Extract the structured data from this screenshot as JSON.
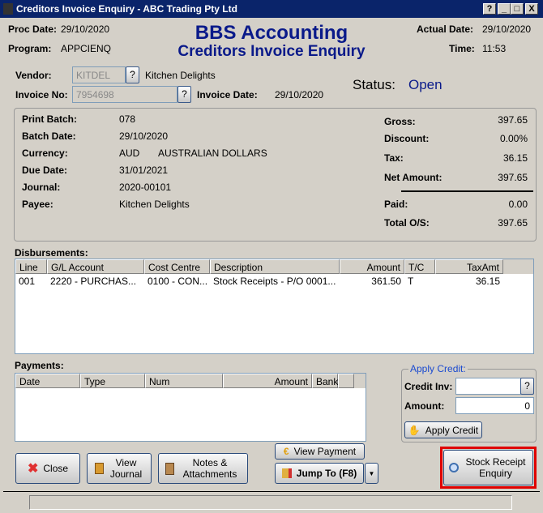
{
  "window": {
    "title": "Creditors Invoice Enquiry - ABC Trading Pty Ltd",
    "help": "?",
    "minimize": "_",
    "maximize": "□",
    "close": "X"
  },
  "header": {
    "proc_date_label": "Proc Date:",
    "proc_date": "29/10/2020",
    "program_label": "Program:",
    "program": "APPCIENQ",
    "app_title": "BBS Accounting",
    "screen_title": "Creditors Invoice Enquiry",
    "actual_date_label": "Actual Date:",
    "actual_date": "29/10/2020",
    "time_label": "Time:",
    "time": "11:53"
  },
  "vendor": {
    "label": "Vendor:",
    "code": "KITDEL",
    "name": "Kitchen Delights",
    "invoice_label": "Invoice No:",
    "invoice_no": "7954698",
    "invoice_date_label": "Invoice Date:",
    "invoice_date": "29/10/2020",
    "lookup": "?"
  },
  "status": {
    "label": "Status:",
    "value": "Open"
  },
  "details": {
    "print_batch_label": "Print Batch:",
    "print_batch": "078",
    "batch_date_label": "Batch Date:",
    "batch_date": "29/10/2020",
    "currency_label": "Currency:",
    "currency_code": "AUD",
    "currency_name": "AUSTRALIAN DOLLARS",
    "due_date_label": "Due Date:",
    "due_date": "31/01/2021",
    "journal_label": "Journal:",
    "journal": "2020-00101",
    "payee_label": "Payee:",
    "payee": "Kitchen Delights"
  },
  "totals": {
    "gross_label": "Gross:",
    "gross": "397.65",
    "discount_label": "Discount:",
    "discount": "0.00%",
    "tax_label": "Tax:",
    "tax": "36.15",
    "net_label": "Net Amount:",
    "net": "397.65",
    "paid_label": "Paid:",
    "paid": "0.00",
    "os_label": "Total O/S:",
    "os": "397.65"
  },
  "disbursements": {
    "label": "Disbursements:",
    "columns": [
      "Line",
      "G/L Account",
      "Cost Centre",
      "Description",
      "Amount",
      "T/C",
      "TaxAmt"
    ],
    "rows": [
      [
        "001",
        "2220   - PURCHAS...",
        "0100 - CON...",
        "Stock Receipts - P/O 0001...",
        "361.50",
        "T",
        "36.15"
      ]
    ]
  },
  "payments": {
    "label": "Payments:",
    "columns": [
      "Date",
      "Type",
      "Num",
      "Amount",
      "Bank"
    ]
  },
  "apply_credit": {
    "legend": "Apply Credit:",
    "credit_inv_label": "Credit Inv:",
    "credit_inv": "",
    "amount_label": "Amount:",
    "amount": "0",
    "button": "Apply Credit"
  },
  "buttons": {
    "close": "Close",
    "view_journal": "View Journal",
    "notes": "Notes & Attachments",
    "view_payment": "View Payment",
    "jump_to": "Jump To (F8)",
    "stock_receipt": "Stock Receipt Enquiry"
  },
  "colors": {
    "title_bar": "#0a246a",
    "heading": "#0a1a8a",
    "highlight": "#e00000"
  }
}
